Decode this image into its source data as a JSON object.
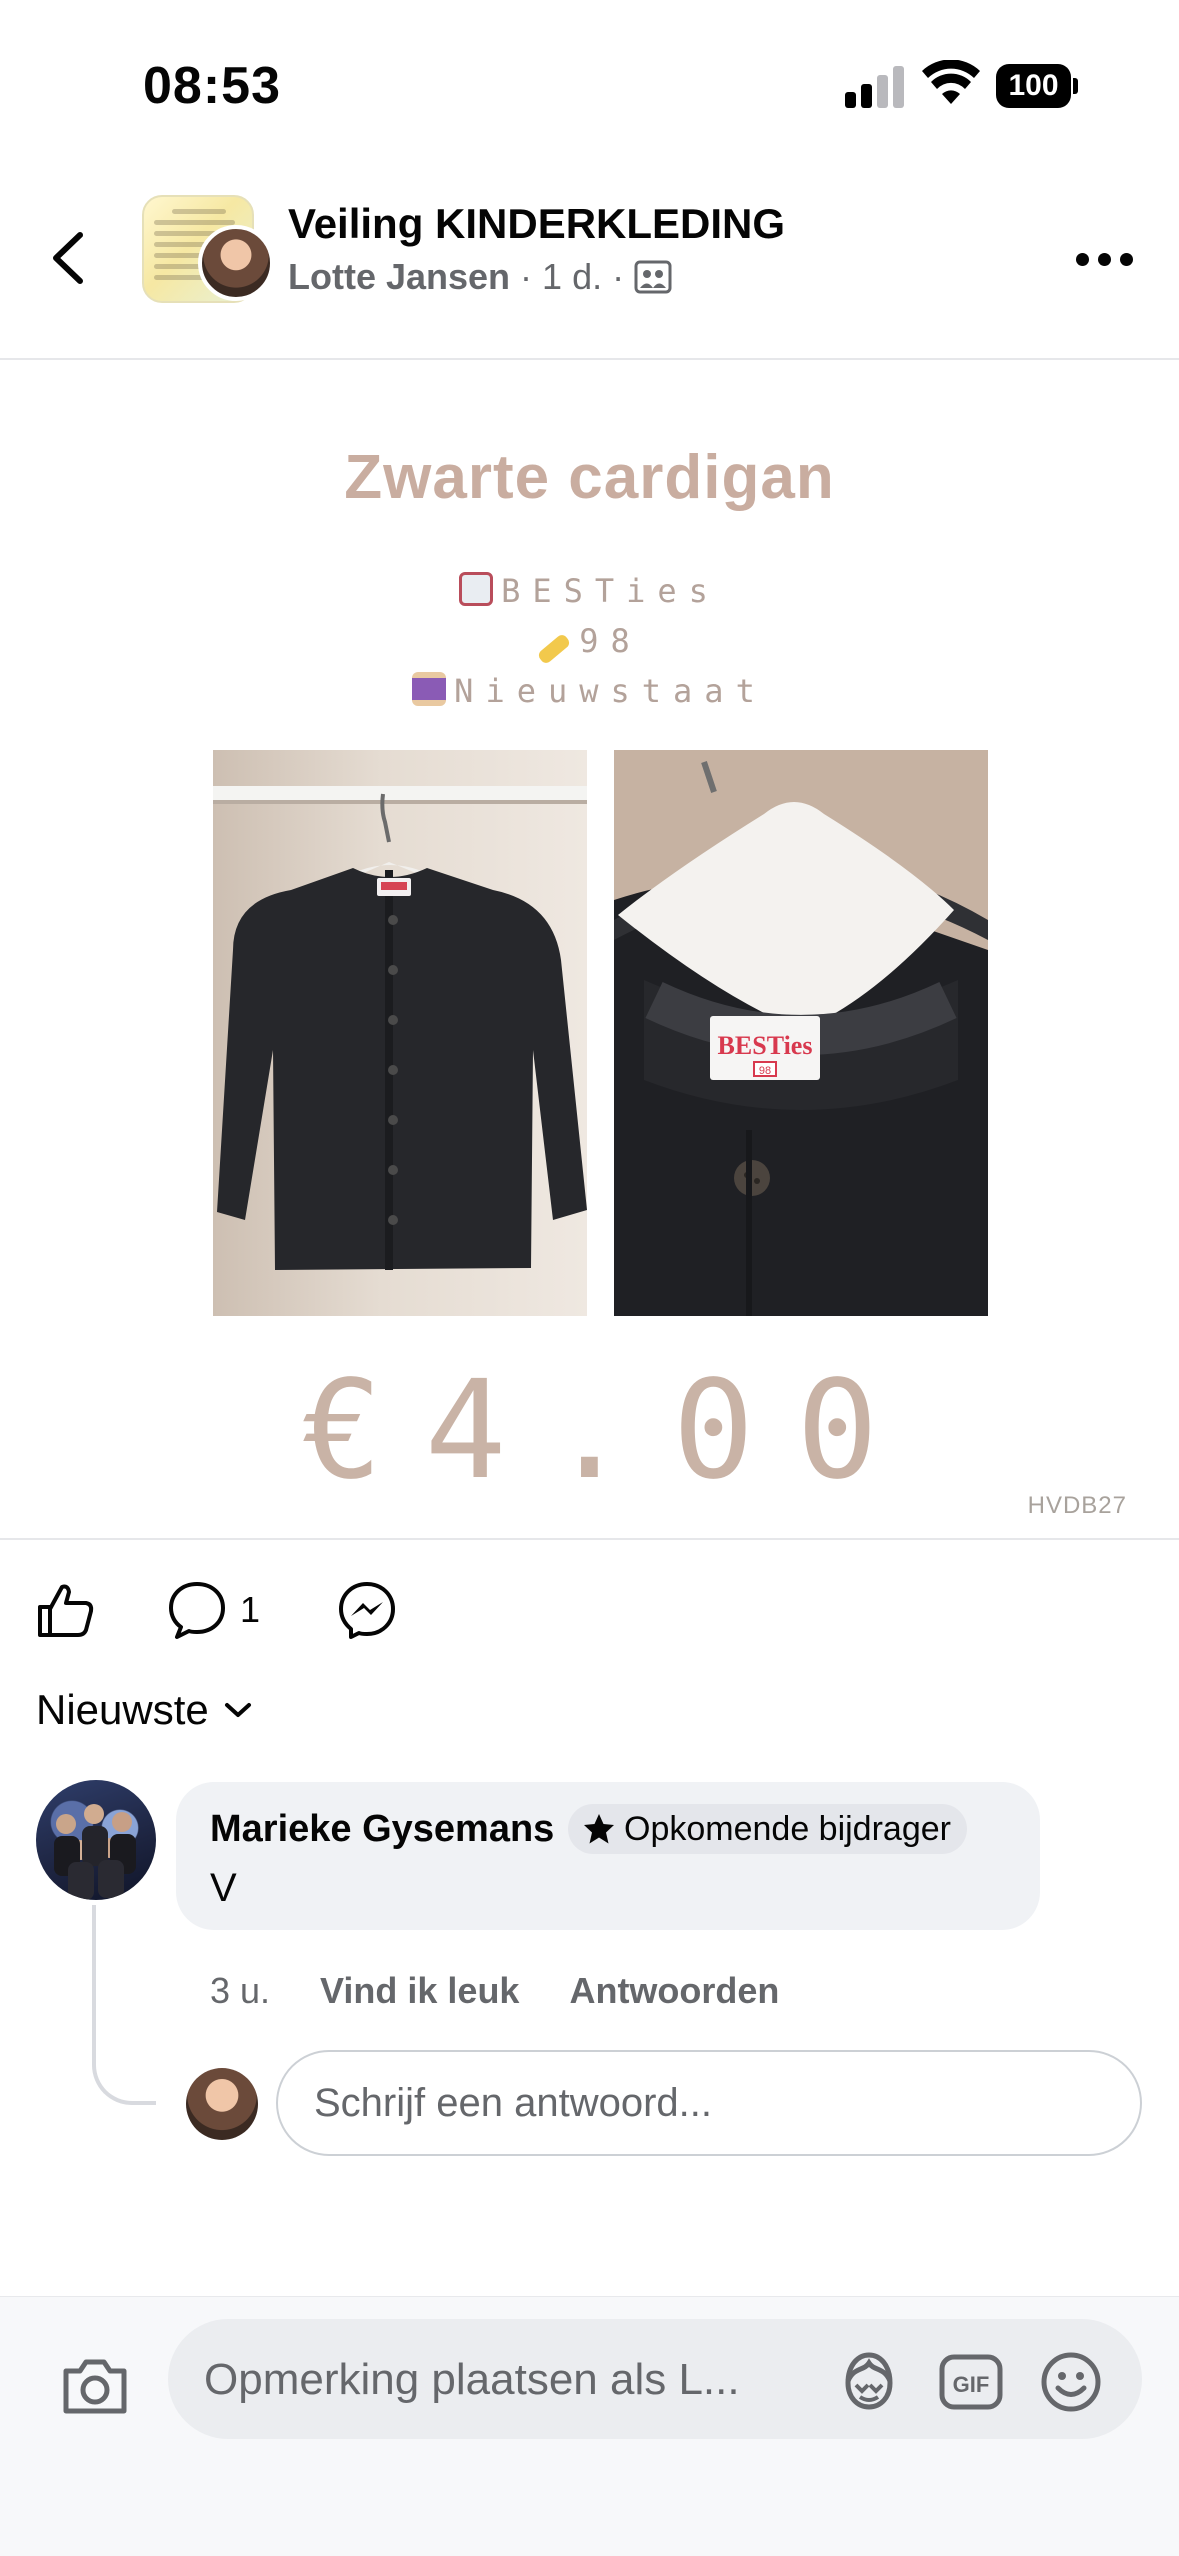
{
  "status_bar": {
    "time": "08:53",
    "battery": "100"
  },
  "header": {
    "title": "Veiling KINDERKLEDING",
    "author": "Lotte Jansen",
    "separator": "·",
    "age": "1 d.",
    "separator2": "·"
  },
  "post_image": {
    "title": "Zwarte cardigan",
    "brand": "BESTies",
    "size": "98",
    "condition": "Nieuwstaat",
    "price": "€4.00",
    "watermark": "HVDB27",
    "label_brand": "BESTies",
    "label_size": "98"
  },
  "actions": {
    "comment_count": "1"
  },
  "sort": {
    "label": "Nieuwste"
  },
  "comments": [
    {
      "name": "Marieke Gysemans",
      "badge": "Opkomende bijdrager",
      "text": "V",
      "time": "3 u.",
      "like_label": "Vind ik leuk",
      "reply_label": "Antwoorden"
    }
  ],
  "reply": {
    "placeholder": "Schrijf een antwoord..."
  },
  "composer": {
    "placeholder": "Opmerking plaatsen als L..."
  },
  "colors": {
    "accent_title": "#c9ada0",
    "price": "#c9b3a6",
    "text": "#050505",
    "muted": "#65676b"
  },
  "icons": [
    "back-arrow-icon",
    "group-icon",
    "more-icon",
    "like-icon",
    "comment-icon",
    "messenger-icon",
    "chevron-down-icon",
    "star-icon",
    "camera-icon",
    "avatar-sticker-icon",
    "gif-icon",
    "emoji-icon"
  ]
}
